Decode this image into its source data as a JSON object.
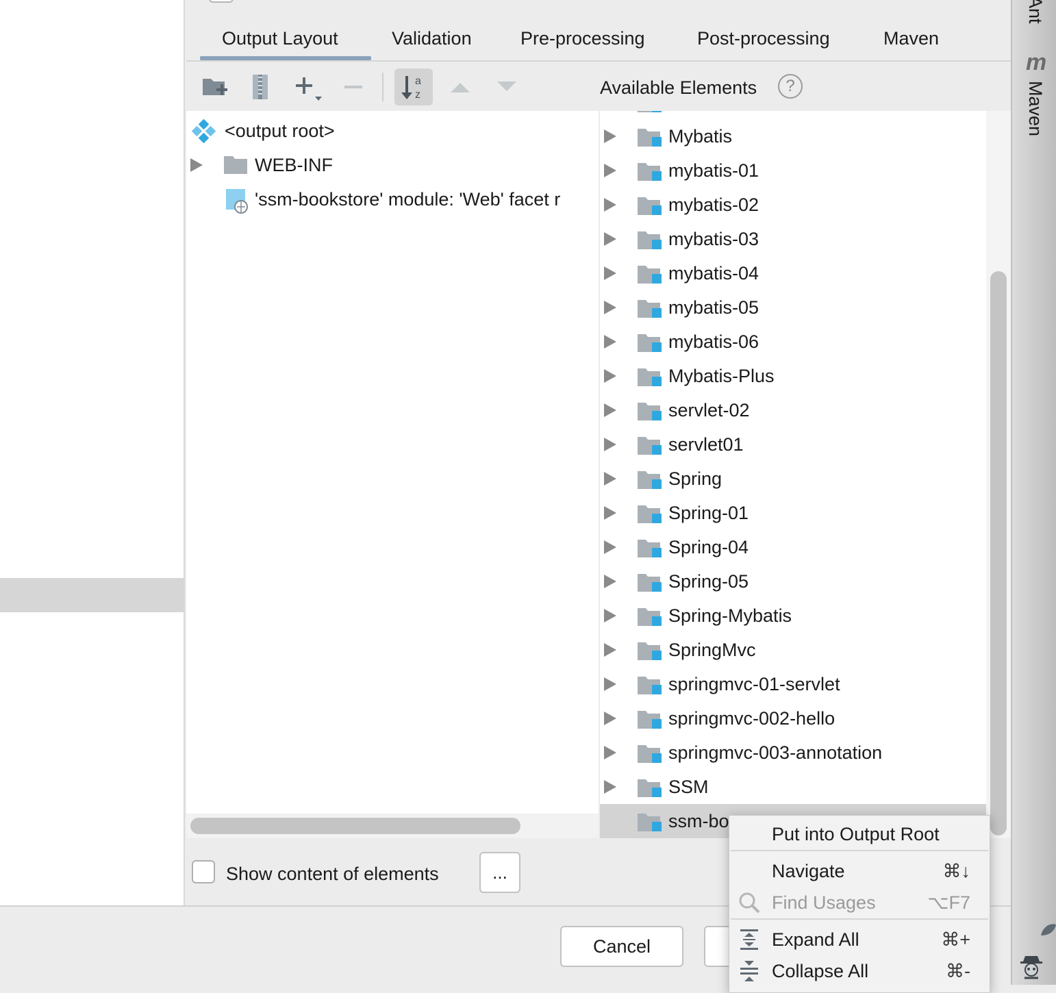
{
  "tabs": [
    {
      "label": "Output Layout",
      "active": true
    },
    {
      "label": "Validation"
    },
    {
      "label": "Pre-processing"
    },
    {
      "label": "Post-processing"
    },
    {
      "label": "Maven"
    }
  ],
  "toolbar": {
    "icons": [
      "new-directory-icon",
      "archive-icon",
      "add-icon",
      "remove-icon",
      "sort-alpha-icon",
      "move-up-icon",
      "move-down-icon"
    ]
  },
  "available_label": "Available Elements",
  "help_glyph": "?",
  "layout_tree": {
    "root": "<output root>",
    "items": [
      {
        "label": "WEB-INF",
        "type": "folder"
      },
      {
        "label": "'ssm-bookstore' module: 'Web' facet r",
        "type": "web-facet"
      }
    ]
  },
  "available_tree": {
    "items": [
      "Mybatis",
      "mybatis-01",
      "mybatis-02",
      "mybatis-03",
      "mybatis-04",
      "mybatis-05",
      "mybatis-06",
      "Mybatis-Plus",
      "servlet-02",
      "servlet01",
      "Spring",
      "Spring-01",
      "Spring-04",
      "Spring-05",
      "Spring-Mybatis",
      "SpringMvc",
      "springmvc-01-servlet",
      "springmvc-002-hello",
      "springmvc-003-annotation",
      "SSM"
    ],
    "selected": "ssm-bo"
  },
  "bottom": {
    "show_content_label": "Show content of elements",
    "more_label": "...",
    "cancel_label": "Cancel"
  },
  "right_strip": {
    "ant_label": "Ant",
    "maven_glyph": "m",
    "maven_label": "Maven"
  },
  "context_menu": {
    "items": [
      {
        "label": "Put into Output Root",
        "shortcut": ""
      },
      {
        "label": "Navigate",
        "shortcut": "⌘↓"
      },
      {
        "label": "Find Usages",
        "shortcut": "⌥F7",
        "disabled": true
      },
      {
        "label": "Expand All",
        "shortcut": "⌘+"
      },
      {
        "label": "Collapse All",
        "shortcut": "⌘-"
      }
    ]
  },
  "colors": {
    "module_icon_accent": "#2fa8e0",
    "folder_gray": "#a9b0b6",
    "tab_underline": "#8aa3bb"
  }
}
